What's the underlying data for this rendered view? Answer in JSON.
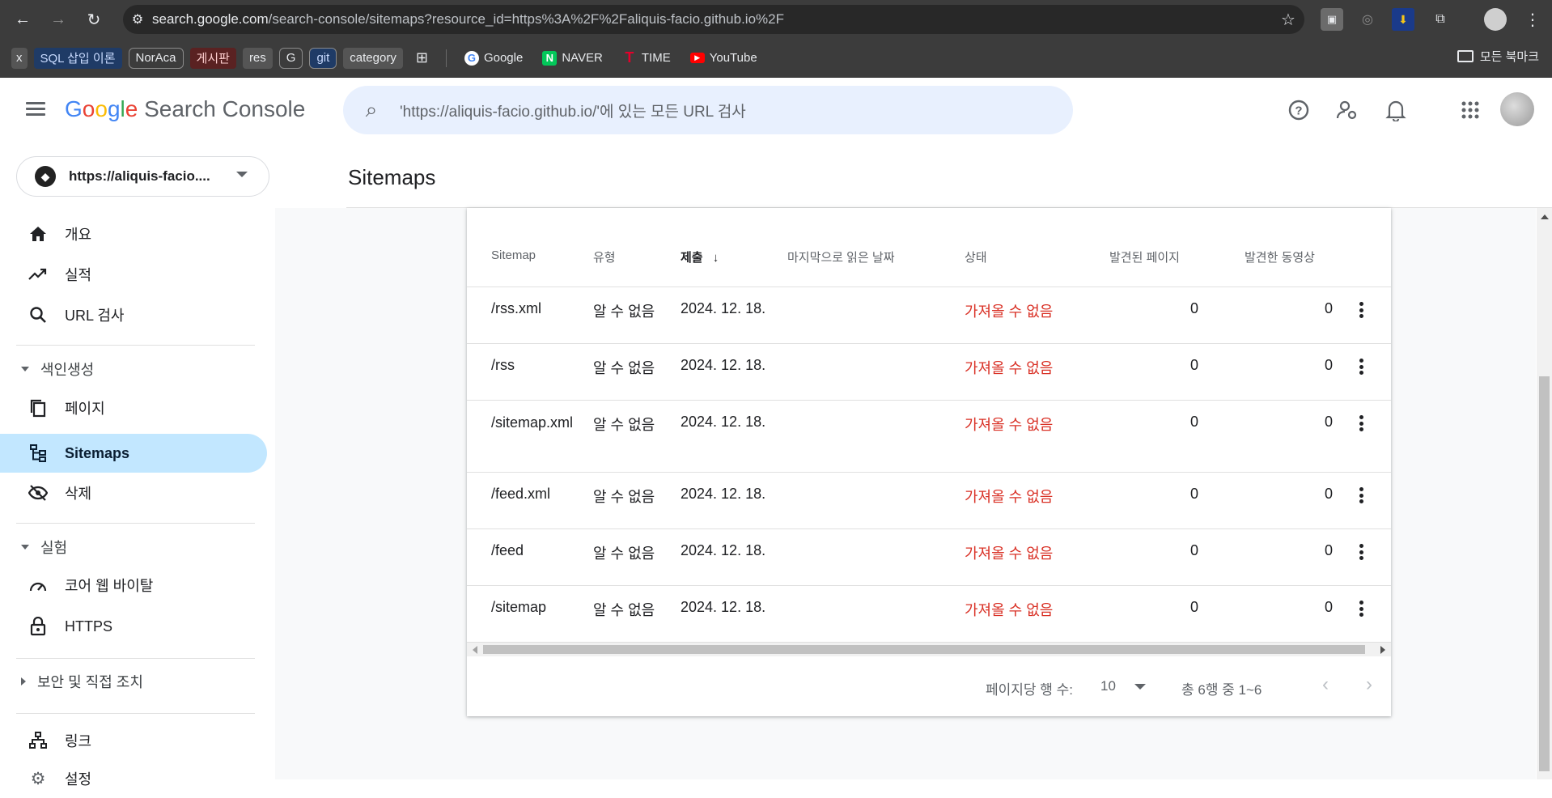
{
  "browser": {
    "url_host": "search.google.com",
    "url_path": "/search-console/sitemaps?resource_id=https%3A%2F%2Faliquis-facio.github.io%2F",
    "bookmarks": [
      {
        "label": "x",
        "style": "plain"
      },
      {
        "label": "SQL 삽입 이론",
        "style": "blue"
      },
      {
        "label": "NorAca",
        "style": "pill"
      },
      {
        "label": "게시판",
        "style": "red"
      },
      {
        "label": "res",
        "style": "plain"
      },
      {
        "label": "G",
        "style": "pill"
      },
      {
        "label": "git",
        "style": "pill-blue"
      },
      {
        "label": "category",
        "style": "plain"
      }
    ],
    "fav_bookmarks": [
      {
        "label": "Google",
        "icon": "G",
        "color": "#4285f4"
      },
      {
        "label": "NAVER",
        "icon": "N",
        "color": "#03c75a"
      },
      {
        "label": "TIME",
        "icon": "T",
        "color": "#e4002b"
      },
      {
        "label": "YouTube",
        "icon": "▶",
        "color": "#ff0000"
      }
    ],
    "all_bookmarks_label": "모든 북마크"
  },
  "header": {
    "logo_text": "Search Console",
    "search_placeholder": "'https://aliquis-facio.github.io/'에 있는 모든 URL 검사"
  },
  "sidebar": {
    "property": "https://aliquis-facio....",
    "items": [
      {
        "label": "개요",
        "icon": "home-icon"
      },
      {
        "label": "실적",
        "icon": "trending-icon"
      },
      {
        "label": "URL 검사",
        "icon": "search-icon"
      },
      {
        "section": "색인생성"
      },
      {
        "label": "페이지",
        "icon": "pages-icon"
      },
      {
        "label": "Sitemaps",
        "icon": "sitemap-icon",
        "active": true
      },
      {
        "label": "삭제",
        "icon": "eye-off-icon"
      },
      {
        "section": "실험"
      },
      {
        "label": "코어 웹 바이탈",
        "icon": "gauge-icon"
      },
      {
        "label": "HTTPS",
        "icon": "lock-icon"
      },
      {
        "section": "보안 및 직접 조치"
      },
      {
        "label": "링크",
        "icon": "links-icon"
      },
      {
        "label": "설정",
        "icon": "gear-icon"
      }
    ]
  },
  "main": {
    "title": "Sitemaps",
    "columns": [
      "Sitemap",
      "유형",
      "제출",
      "마지막으로 읽은 날짜",
      "상태",
      "발견된 페이지",
      "발견한 동영상"
    ],
    "rows": [
      {
        "sitemap": "/rss.xml",
        "type": "알 수 없음",
        "submitted": "2024. 12. 18.",
        "last_read": "",
        "status": "가져올 수 없음",
        "pages": "0",
        "videos": "0"
      },
      {
        "sitemap": "/rss",
        "type": "알 수 없음",
        "submitted": "2024. 12. 18.",
        "last_read": "",
        "status": "가져올 수 없음",
        "pages": "0",
        "videos": "0"
      },
      {
        "sitemap": "/sitemap.xml",
        "type": "알 수 없음",
        "submitted": "2024. 12. 18.",
        "last_read": "",
        "status": "가져올 수 없음",
        "pages": "0",
        "videos": "0"
      },
      {
        "sitemap": "/feed.xml",
        "type": "알 수 없음",
        "submitted": "2024. 12. 18.",
        "last_read": "",
        "status": "가져올 수 없음",
        "pages": "0",
        "videos": "0"
      },
      {
        "sitemap": "/feed",
        "type": "알 수 없음",
        "submitted": "2024. 12. 18.",
        "last_read": "",
        "status": "가져올 수 없음",
        "pages": "0",
        "videos": "0"
      },
      {
        "sitemap": "/sitemap",
        "type": "알 수 없음",
        "submitted": "2024. 12. 18.",
        "last_read": "",
        "status": "가져올 수 없음",
        "pages": "0",
        "videos": "0"
      }
    ],
    "pager": {
      "rows_per_page_label": "페이지당 행 수:",
      "rows_per_page_value": "10",
      "range": "총 6행 중 1~6"
    }
  },
  "colors": {
    "active_nav": "#c2e7ff",
    "error_text": "#d93025",
    "search_bg": "#e8f0fe"
  }
}
